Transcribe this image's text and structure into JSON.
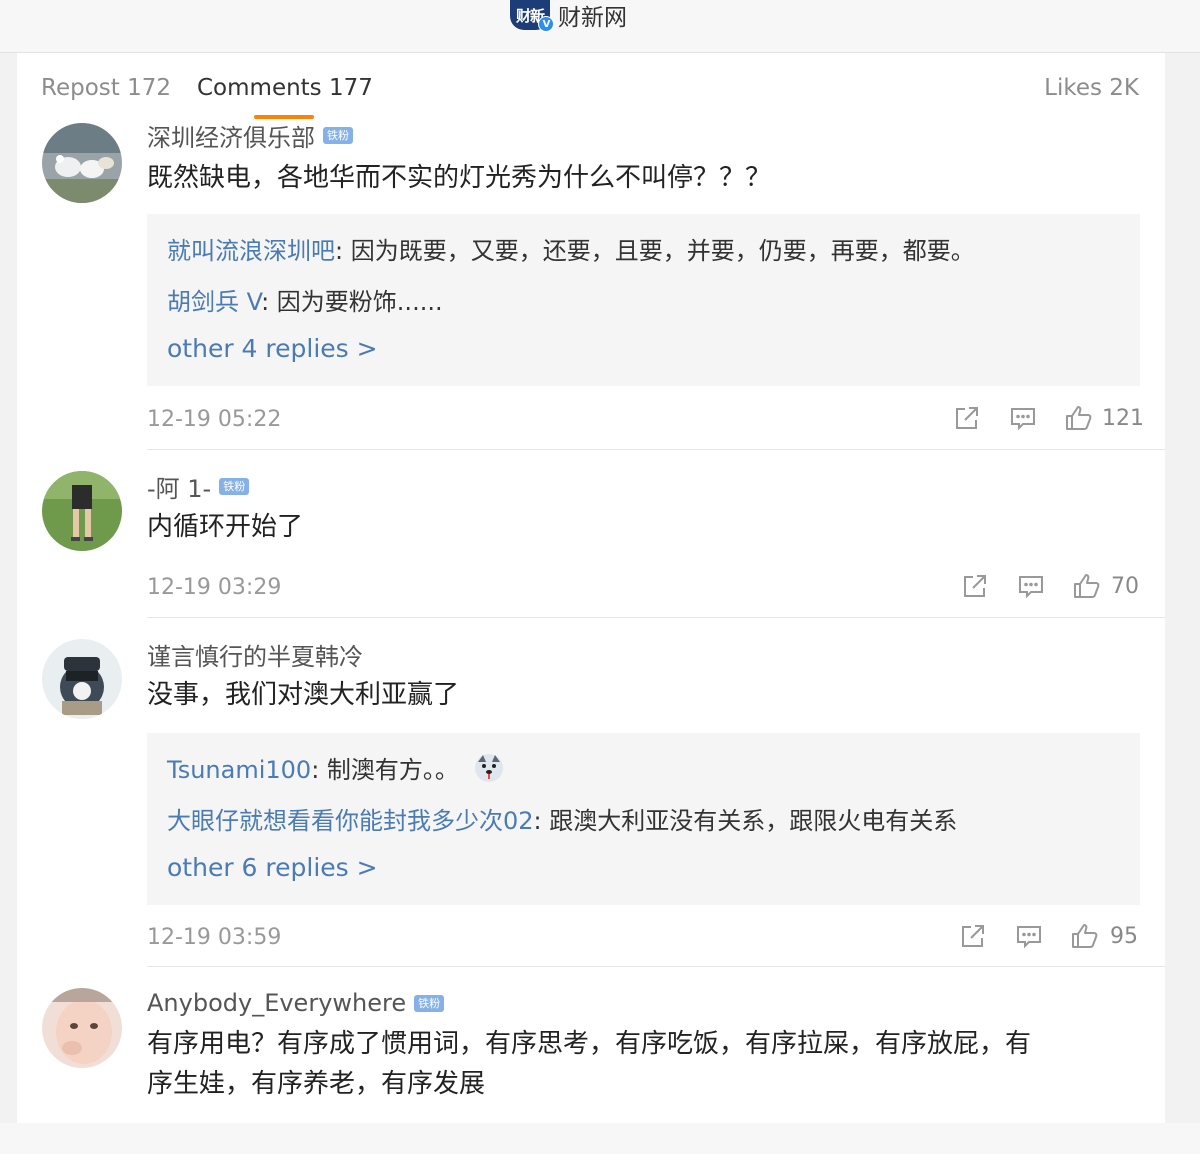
{
  "brand": {
    "logo_text": "财新",
    "verified_mark": "V",
    "name": "财新网"
  },
  "tabs": {
    "repost": "Repost 172",
    "comments": "Comments 177",
    "likes": "Likes 2K"
  },
  "colors": {
    "tab_accent": "#ff8200",
    "reply_user": "#4a7bb5",
    "fan_badge": "#86b1e6"
  },
  "icons": [
    "share-icon",
    "comment-icon",
    "thumbs-up-icon"
  ],
  "comments": [
    {
      "username": "深圳经济俱乐部",
      "badge": "铁粉",
      "text": "既然缺电，各地华而不实的灯光秀为什么不叫停？？？",
      "replies": [
        {
          "user": "就叫流浪深圳吧",
          "text": ": 因为既要，又要，还要，且要，并要，仍要，再要，都要。"
        },
        {
          "user": "胡剑兵 V",
          "text": ": 因为要粉饰......"
        }
      ],
      "more_replies": "other 4 replies >",
      "time": "12-19 05:22",
      "likes": "121"
    },
    {
      "username": "-阿 1-",
      "badge": "铁粉",
      "text": "内循环开始了",
      "time": "12-19 03:29",
      "likes": "70"
    },
    {
      "username": "谨言慎行的半夏韩冷",
      "text": "没事，我们对澳大利亚赢了",
      "replies": [
        {
          "user": "Tsunami100",
          "text": ": 制澳有方。。"
        },
        {
          "user": "大眼仔就想看看你能封我多少次02",
          "text": ": 跟澳大利亚没有关系，跟限火电有关系"
        }
      ],
      "more_replies": "other 6 replies >",
      "time": "12-19 03:59",
      "likes": "95"
    },
    {
      "username": "Anybody_Everywhere",
      "badge": "铁粉",
      "text_line1": "有序用电？有序成了惯用词，有序思考，有序吃饭，有序拉屎，有序放屁，有",
      "text_line2": "序生娃，有序养老，有序发展"
    }
  ]
}
